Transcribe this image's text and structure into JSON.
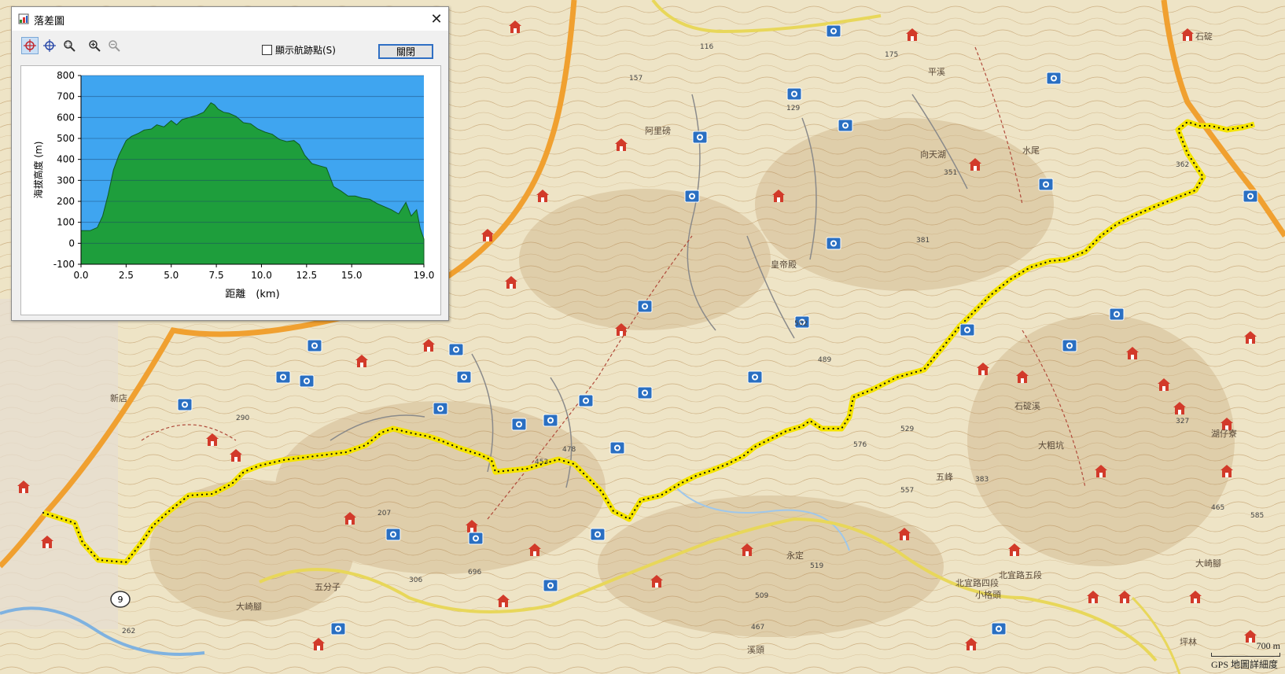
{
  "window": {
    "title": "落差圖",
    "close_glyph": "✕",
    "toolbar": {
      "tools": [
        {
          "name": "select-track-icon",
          "active": true
        },
        {
          "name": "crosshair-icon",
          "active": false
        },
        {
          "name": "zoom-area-icon",
          "active": false
        },
        {
          "name": "zoom-in-icon",
          "active": false
        },
        {
          "name": "zoom-out-icon",
          "active": false
        }
      ],
      "show_waypoints_label": "顯示航跡點(S)",
      "show_waypoints_checked": false,
      "close_button_label": "關閉"
    }
  },
  "chart_data": {
    "type": "area",
    "title": "",
    "xlabel": "距離　(km)",
    "ylabel": "海拔高度 (m)",
    "xlim": [
      0,
      19.0
    ],
    "ylim": [
      -100,
      800
    ],
    "x_ticks": [
      "0.0",
      "2.5",
      "5.0",
      "7.5",
      "10.0",
      "12.5",
      "15.0",
      "19.0"
    ],
    "y_ticks": [
      "800",
      "700",
      "600",
      "500",
      "400",
      "300",
      "200",
      "100",
      "0",
      "-100"
    ],
    "grid": true,
    "fill_color": "#1e9e3c",
    "background_color": "#3fa5f0",
    "x": [
      0,
      0.5,
      0.9,
      1.2,
      1.5,
      1.8,
      2.1,
      2.5,
      2.8,
      3.2,
      3.5,
      3.9,
      4.2,
      4.6,
      5.0,
      5.3,
      5.6,
      6.0,
      6.4,
      6.8,
      7.2,
      7.4,
      7.6,
      7.9,
      8.2,
      8.6,
      9.0,
      9.4,
      9.8,
      10.2,
      10.6,
      11.0,
      11.4,
      11.8,
      12.1,
      12.4,
      12.8,
      13.2,
      13.6,
      14.0,
      14.4,
      14.8,
      15.2,
      15.6,
      16.0,
      16.4,
      16.8,
      17.2,
      17.6,
      18.0,
      18.3,
      18.6,
      18.8,
      19.0
    ],
    "y": [
      60,
      60,
      75,
      130,
      230,
      350,
      420,
      490,
      510,
      525,
      540,
      545,
      565,
      555,
      585,
      565,
      590,
      600,
      610,
      625,
      670,
      660,
      640,
      625,
      620,
      605,
      575,
      570,
      545,
      530,
      520,
      495,
      485,
      490,
      470,
      420,
      380,
      370,
      360,
      270,
      250,
      225,
      225,
      215,
      210,
      190,
      175,
      160,
      140,
      195,
      130,
      160,
      70,
      20
    ]
  },
  "map": {
    "route_color": "#f5e400",
    "labels": [
      "北宜路五段",
      "北宜路四段",
      "五分子",
      "大崎腳",
      "大崎腳",
      "阿里磅",
      "石碇",
      "平溪",
      "湖仔寮",
      "向天湖",
      "水尾",
      "永定",
      "五峰",
      "石碇溪",
      "大粗坑",
      "小格頭",
      "皇帝殿",
      "新店",
      "溪頭",
      "坪林"
    ],
    "elevation_marks": [
      "175",
      "116",
      "157",
      "129",
      "351",
      "362",
      "381",
      "502",
      "489",
      "478",
      "453",
      "576",
      "529",
      "557",
      "383",
      "327",
      "465",
      "585",
      "290",
      "207",
      "306",
      "696",
      "519",
      "509",
      "467",
      "262"
    ],
    "road_badge": "9",
    "scale": {
      "distance": "700 m",
      "detail_label": "GPS 地圖詳細度"
    }
  }
}
